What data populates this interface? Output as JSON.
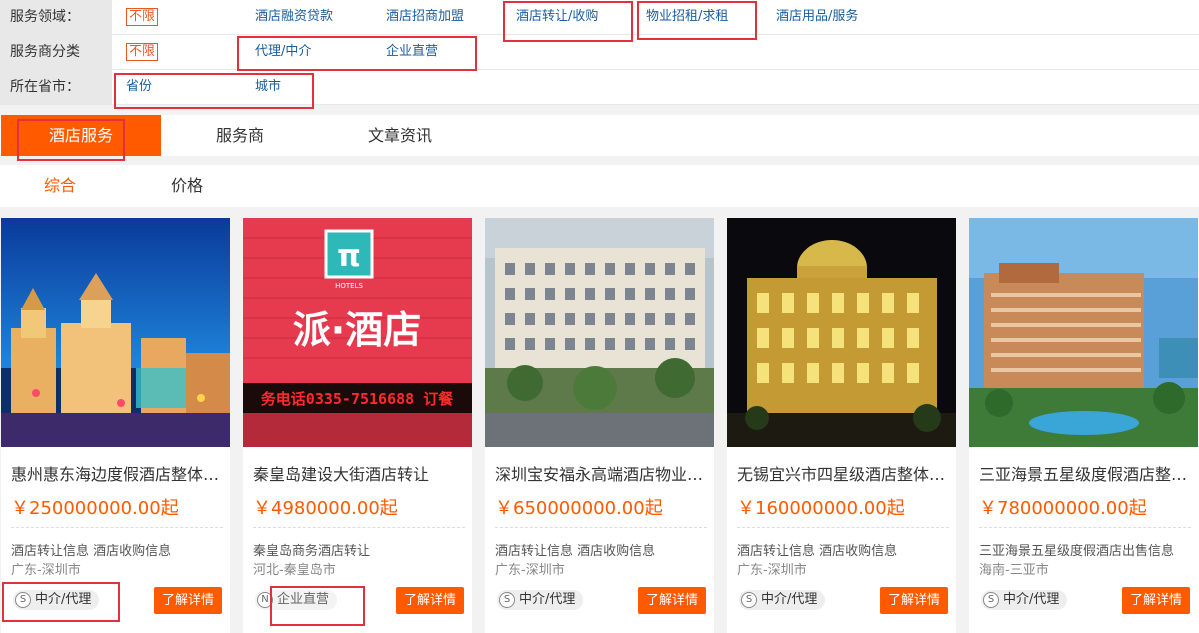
{
  "filters": {
    "domain": {
      "label": "服务领域：",
      "options": [
        "不限",
        "酒店融资贷款",
        "酒店招商加盟",
        "酒店转让/收购",
        "物业招租/求租",
        "酒店用品/服务"
      ]
    },
    "provider_type": {
      "label": "服务商分类",
      "options": [
        "不限",
        "代理/中介",
        "企业直营"
      ]
    },
    "location": {
      "label": "所在省市：",
      "options": [
        "省份",
        "城市"
      ]
    }
  },
  "tabs": [
    "酒店服务",
    "服务商",
    "文章资讯"
  ],
  "sort": [
    "综合",
    "价格"
  ],
  "colors": {
    "accent": "#ff5a00",
    "link": "#1a5c9e",
    "highlight": "#e0313d"
  },
  "cards": [
    {
      "title": "惠州惠东海边度假酒店整体转让",
      "price": "￥250000000.00起",
      "desc": "酒店转让信息 酒店收购信息",
      "location": "广东-深圳市",
      "badge_icon": "S",
      "badge": "中介/代理",
      "button": "了解详情",
      "image": "resort-night-castle-image"
    },
    {
      "title": "秦皇岛建设大街酒店转让",
      "price": "￥4980000.00起",
      "desc": "秦皇岛商务酒店转让",
      "location": "河北-秦皇岛市",
      "badge_icon": "N",
      "badge": "企业直营",
      "button": "了解详情",
      "image": "pai-hotel-sign-image",
      "sign_text": "派·酒店",
      "sign_brand": "HOTELS",
      "sign_logo": "π",
      "sign_led": "务电话0335-7516688 订餐"
    },
    {
      "title": "深圳宝安福永高端酒店物业出租",
      "price": "￥650000000.00起",
      "desc": "酒店转让信息 酒店收购信息",
      "location": "广东-深圳市",
      "badge_icon": "S",
      "badge": "中介/代理",
      "button": "了解详情",
      "image": "hotel-building-daylight-image"
    },
    {
      "title": "无锡宜兴市四星级酒店整体转让",
      "price": "￥160000000.00起",
      "desc": "酒店转让信息 酒店收购信息",
      "location": "广东-深圳市",
      "badge_icon": "S",
      "badge": "中介/代理",
      "button": "了解详情",
      "image": "domed-hotel-night-image"
    },
    {
      "title": "三亚海景五星级度假酒店整体出售",
      "price": "￥780000000.00起",
      "desc": "三亚海景五星级度假酒店出售信息",
      "location": "海南-三亚市",
      "badge_icon": "S",
      "badge": "中介/代理",
      "button": "了解详情",
      "image": "beach-resort-image"
    }
  ]
}
